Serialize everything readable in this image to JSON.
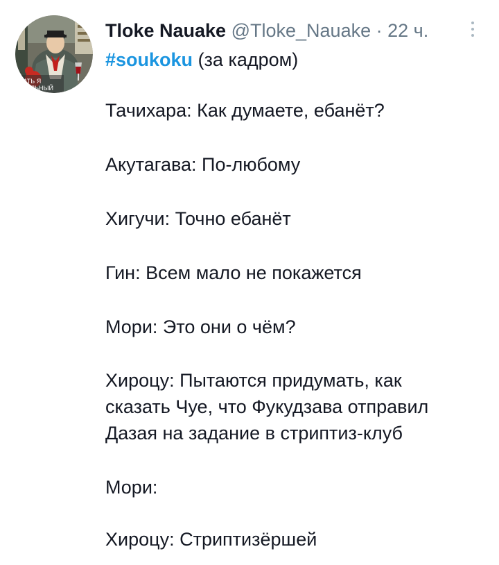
{
  "tweet": {
    "author_name": "Tloke Nauake",
    "author_handle": "@Tloke_Nauake",
    "separator": "·",
    "timestamp": "22 ч.",
    "hashtag": "#soukoku",
    "hashtag_suffix": "(за кадром)",
    "avatar_caption_lines": [
      "...АТЬ Я",
      "...ИАЛЬНЫЙ"
    ],
    "lines": [
      "Тачихара: Как думаете, ебанёт?",
      "Акутагава: По-любому",
      "Хигучи: Точно ебанёт",
      "Гин: Всем мало не покажется",
      "Мори: Это они о чём?",
      "Хироцу: Пытаются придумать, как",
      "сказать Чуе, что Фукудзава отправил",
      "Дазая на задание в стриптиз-клуб",
      "Мори:",
      "Хироцу: Стриптизёршей"
    ]
  },
  "colors": {
    "text": "#141823",
    "secondary": "#657786",
    "hashtag": "#1b95e0",
    "more_dots": "#aab8c2"
  },
  "icons": {
    "more": "more-vertical-icon"
  }
}
